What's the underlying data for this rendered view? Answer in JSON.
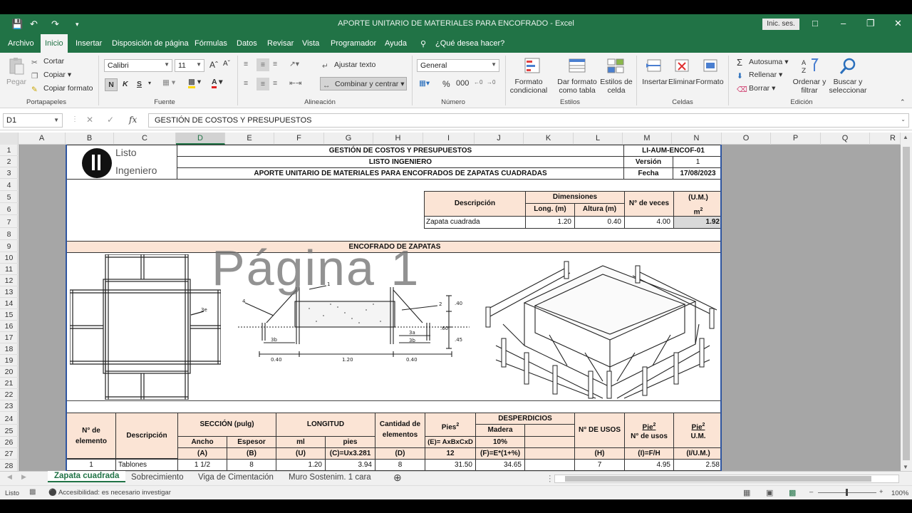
{
  "window": {
    "title": "APORTE UNITARIO DE MATERIALES PARA ENCOFRADO - Excel",
    "signin": "Inic. ses.",
    "accent": "#217346"
  },
  "menu": {
    "tabs": [
      "Archivo",
      "Inicio",
      "Insertar",
      "Disposición de página",
      "Fórmulas",
      "Datos",
      "Revisar",
      "Vista",
      "Programador",
      "Ayuda"
    ],
    "active": "Inicio",
    "tell_me": "¿Qué desea hacer?"
  },
  "ribbon": {
    "clipboard": {
      "paste": "Pegar",
      "cut": "Cortar",
      "copy": "Copiar",
      "format_painter": "Copiar formato",
      "label": "Portapapeles"
    },
    "font": {
      "name": "Calibri",
      "size": "11",
      "bold": "N",
      "italic": "K",
      "underline": "S",
      "label": "Fuente"
    },
    "alignment": {
      "wrap": "Ajustar texto",
      "merge": "Combinar y centrar",
      "label": "Alineación"
    },
    "number": {
      "format": "General",
      "label": "Número"
    },
    "styles": {
      "conditional": "Formato condicional",
      "as_table": "Dar formato como tabla",
      "cell_styles": "Estilos de celda",
      "label": "Estilos"
    },
    "cells": {
      "insert": "Insertar",
      "delete": "Eliminar",
      "format": "Formato",
      "label": "Celdas"
    },
    "editing": {
      "autosum": "Autosuma",
      "fill": "Rellenar",
      "clear": "Borrar",
      "sort": "Ordenar y filtrar",
      "find": "Buscar y seleccionar",
      "label": "Edición"
    }
  },
  "formula_bar": {
    "name_box": "D1",
    "fx": "fx",
    "content": "GESTIÓN DE COSTOS Y PRESUPUESTOS"
  },
  "columns": [
    "A",
    "B",
    "C",
    "D",
    "E",
    "F",
    "G",
    "H",
    "I",
    "J",
    "K",
    "L",
    "M",
    "N",
    "O",
    "P",
    "Q",
    "R"
  ],
  "selected_column": "D",
  "rows": [
    "1",
    "2",
    "3",
    "4",
    "5",
    "6",
    "7",
    "8",
    "9",
    "10",
    "11",
    "12",
    "13",
    "14",
    "15",
    "16",
    "17",
    "18",
    "19",
    "20",
    "21",
    "22",
    "23",
    "24",
    "25",
    "26",
    "27",
    "28"
  ],
  "sheet": {
    "logo_line1": "Listo",
    "logo_line2": "Ingeniero",
    "header1": "GESTIÓN DE COSTOS Y PRESUPUESTOS",
    "header2": "LISTO INGENIERO",
    "header3": "APORTE UNITARIO DE MATERIALES PARA ENCOFRADOS DE ZAPATAS CUADRADAS",
    "code": "LI-AUM-ENCOF-01",
    "version_label": "Versión",
    "version_value": "1",
    "date_label": "Fecha",
    "date_value": "17/08/2023",
    "dims_table": {
      "desc_header": "Descripción",
      "dims_header": "Dimensiones",
      "long": "Long. (m)",
      "height": "Altura (m)",
      "times": "N° de veces",
      "um": "(U.M.)",
      "um_unit": "m",
      "um_sup": "2",
      "row_desc": "Zapata cuadrada",
      "row_long": "1.20",
      "row_height": "0.40",
      "row_times": "4.00",
      "row_um": "1.92"
    },
    "section_title": "ENCOFRADO DE ZAPATAS",
    "drawing_labels": {
      "d1": "3e",
      "d2": "1",
      "d3": "2",
      "d4": "4",
      "d5": ".40",
      ".60": ".60",
      "d7": ".45",
      "d8": "3b",
      "d9": "3a",
      "d10": "3b",
      "d11": "0.40",
      "d12": "1.20",
      "d13": "0.40"
    },
    "watermark": "Página 1",
    "main_table": {
      "h_elem": "N° de elemento",
      "h_desc": "Descripción",
      "h_section": "SECCIÓN (pulg)",
      "h_ancho": "Ancho",
      "h_espesor": "Espesor",
      "h_longitud": "LONGITUD",
      "h_ml": "ml",
      "h_pies": "pies",
      "h_cant": "Cantidad de elementos",
      "h_pies2": "Pies",
      "h_pies2_sup": "2",
      "h_desp": "DESPERDICIOS",
      "h_madera": "Madera",
      "h_pct": "10%",
      "h_usos": "N° DE USOS",
      "h_pie_usos": "Pie",
      "h_pie_usos_sup": "2",
      "h_n_usos": "N° de usos",
      "h_pie_um": "Pie",
      "h_pie_um_sup": "2",
      "h_um": "U.M.",
      "f_a": "(A)",
      "f_b": "(B)",
      "f_u": "(U)",
      "f_c": "(C)=Ux3.281",
      "f_d": "(D)",
      "f_e": "(E)= AxBxCxD",
      "f_e2": "12",
      "f_f": "(F)=E*(1+%)",
      "f_h": "(H)",
      "f_i": "(I)=F/H",
      "f_j": "(I/U.M.)",
      "row": {
        "n": "1",
        "desc": "Tablones",
        "ancho": "1 1/2",
        "espesor": "8",
        "ml": "1.20",
        "pies": "3.94",
        "cant": "8",
        "pies2": "31.50",
        "desp": "34.65",
        "usos": "7",
        "pie_usos": "4.95",
        "pie_um": "2.58"
      }
    }
  },
  "sheet_tabs": [
    "Zapata cuadrada",
    "Sobrecimiento",
    "Viga de Cimentación",
    "Muro Sostenim. 1 cara"
  ],
  "active_sheet": "Zapata cuadrada",
  "status": {
    "ready": "Listo",
    "accessibility": "Accesibilidad: es necesario investigar",
    "zoom": "100%"
  }
}
